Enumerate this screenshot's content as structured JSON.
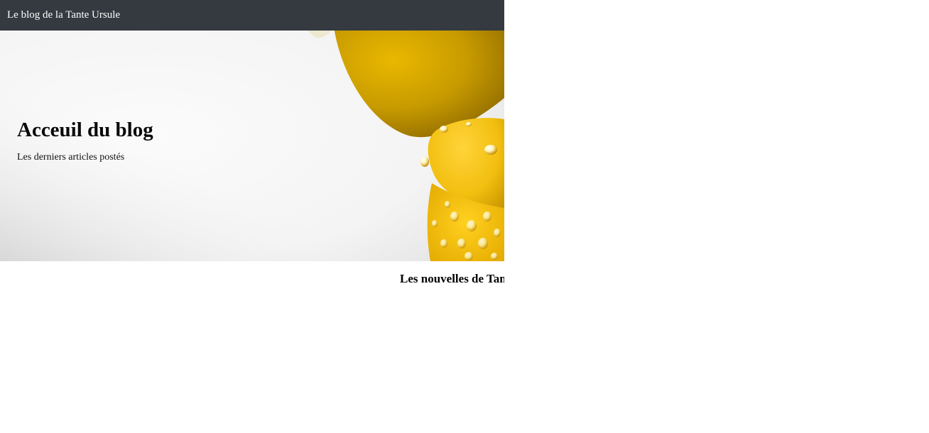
{
  "navbar": {
    "brand": "Le blog de la Tante Ursule"
  },
  "hero": {
    "title": "Acceuil du blog",
    "subtitle": "Les derniers articles postés",
    "image": "yellow-flower-petals-with-water-drops"
  },
  "main": {
    "section_title": "Les nouvelles de Tante Ursule"
  },
  "colors": {
    "navbar_bg": "#343a40",
    "navbar_text": "#ffffff",
    "hero_bg": "#f8f8f8",
    "petal_yellow": "#f2c316",
    "petal_dark": "#b08400"
  }
}
